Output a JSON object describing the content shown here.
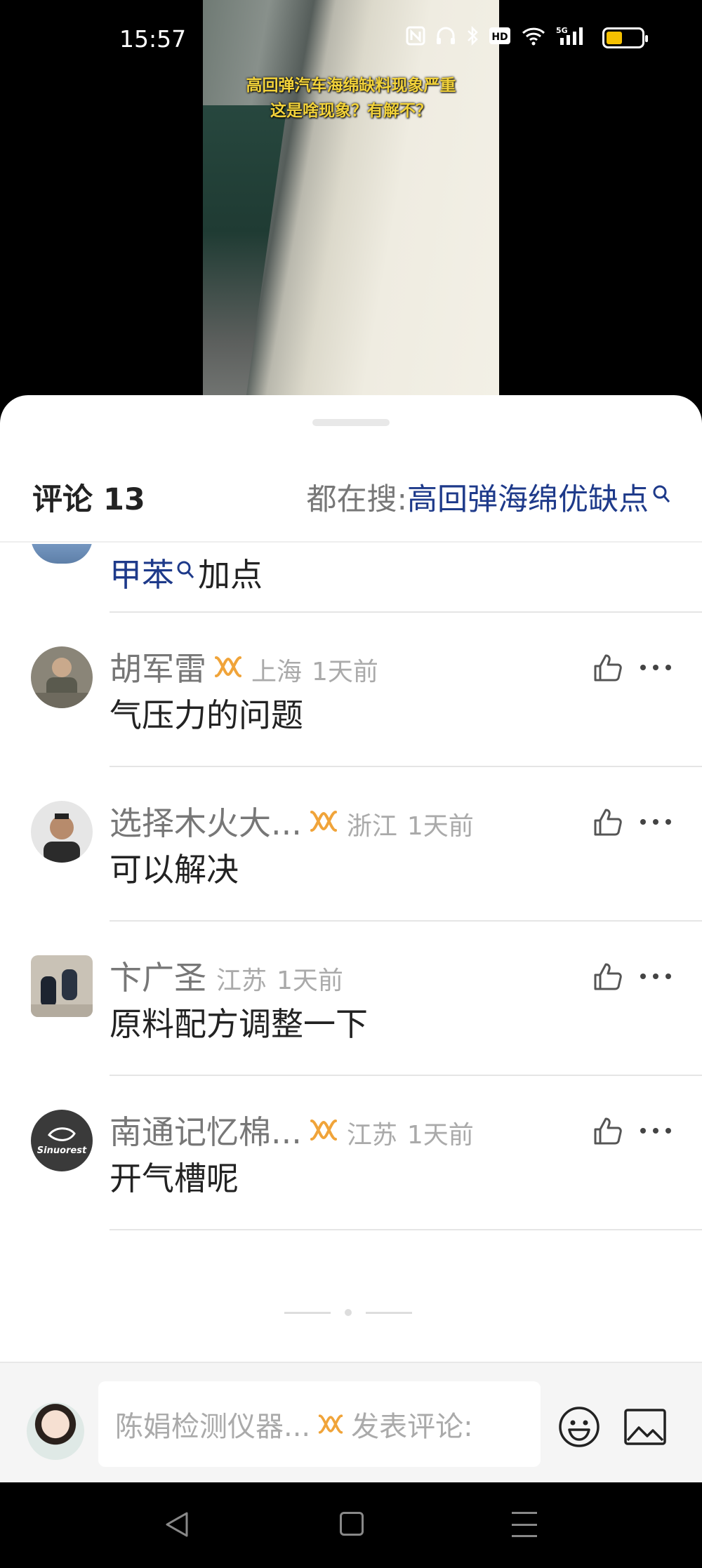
{
  "status_bar": {
    "time": "15:57",
    "icons": [
      "nfc-icon",
      "headphones-icon",
      "bluetooth-icon",
      "hd-icon",
      "wifi-icon",
      "5g-signal-icon",
      "battery-icon"
    ],
    "battery_level": 0.4,
    "battery_color": "#f5c000"
  },
  "video": {
    "caption_line1": "高回弹汽车海绵缺料现象严重",
    "caption_line2": "这是啥现象？有解不？"
  },
  "sheet": {
    "title": "评论 13",
    "search_label": "都在搜: ",
    "search_term": "高回弹海绵优缺点",
    "link_color": "#1e3a8a"
  },
  "partial_comment": {
    "keyword": "甲苯",
    "text": "加点"
  },
  "comments": [
    {
      "name": "胡军雷",
      "location": "上海",
      "time": "1天前",
      "text": "气压力的问题",
      "has_badge": true
    },
    {
      "name": "选择木火大...",
      "location": "浙江",
      "time": "1天前",
      "text": "可以解决",
      "has_badge": true
    },
    {
      "name": "卞广圣",
      "location": "江苏",
      "time": "1天前",
      "text": "原料配方调整一下",
      "has_badge": false
    },
    {
      "name": "南通记忆棉...",
      "location": "江苏",
      "time": "1天前",
      "text": "开气槽呢",
      "has_badge": true
    }
  ],
  "input_bar": {
    "user_name": "陈娟检测仪器...",
    "placeholder": "发表评论:"
  },
  "badge_color": "#f0a43a"
}
